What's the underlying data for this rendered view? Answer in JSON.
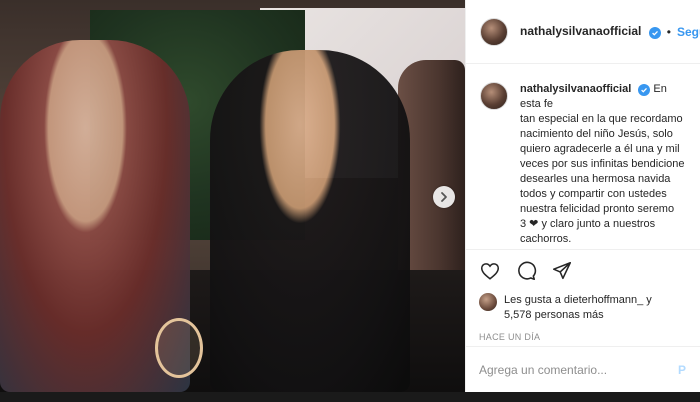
{
  "post": {
    "username": "nathalysilvanaofficial",
    "follow_label": "Seguir",
    "separator": "•",
    "caption_lines": [
      "En esta fe",
      "tan especial en la que recordamo",
      "nacimiento del niño Jesús, solo",
      "quiero agradecerle a él una y mil",
      "veces por sus infinitas bendicione",
      "desearles una hermosa navida",
      "todos y compartir con ustedes",
      "nuestra felicidad pronto seremo",
      "3 ❤ y claro junto a nuestros",
      "cachorros."
    ],
    "likes_line1": "Les gusta a dieterhoffmann_ y",
    "likes_line2": "5,578 personas más",
    "time_ago": "HACE UN DÍA",
    "comment_placeholder": "Agrega un comentario...",
    "post_label": "P"
  },
  "colors": {
    "accent": "#3897f0",
    "verified": "#3897f0",
    "text": "#262626",
    "muted": "#8e8e8e"
  },
  "icons": [
    "chevron-right-icon",
    "verified-badge-icon",
    "heart-icon",
    "comment-icon",
    "share-icon"
  ]
}
